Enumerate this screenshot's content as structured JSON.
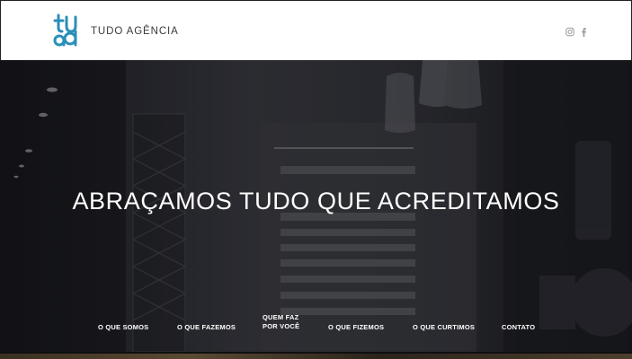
{
  "header": {
    "brand_name": "TUDO AGÊNCIA",
    "logo_icon": "tudo-logo-mark",
    "brand_color": "#2b8fb8",
    "social": [
      {
        "icon": "instagram-icon"
      },
      {
        "icon": "facebook-icon"
      }
    ]
  },
  "hero": {
    "headline": "ABRAÇAMOS TUDO QUE ACREDITAMOS"
  },
  "nav": {
    "items": [
      {
        "label": "O QUE SOMOS"
      },
      {
        "label": "O QUE FAZEMOS"
      },
      {
        "label": "QUEM FAZ",
        "label2": "POR VOCÊ"
      },
      {
        "label": "O QUE FIZEMOS"
      },
      {
        "label": "O QUE CURTIMOS"
      },
      {
        "label": "CONTATO"
      }
    ]
  }
}
